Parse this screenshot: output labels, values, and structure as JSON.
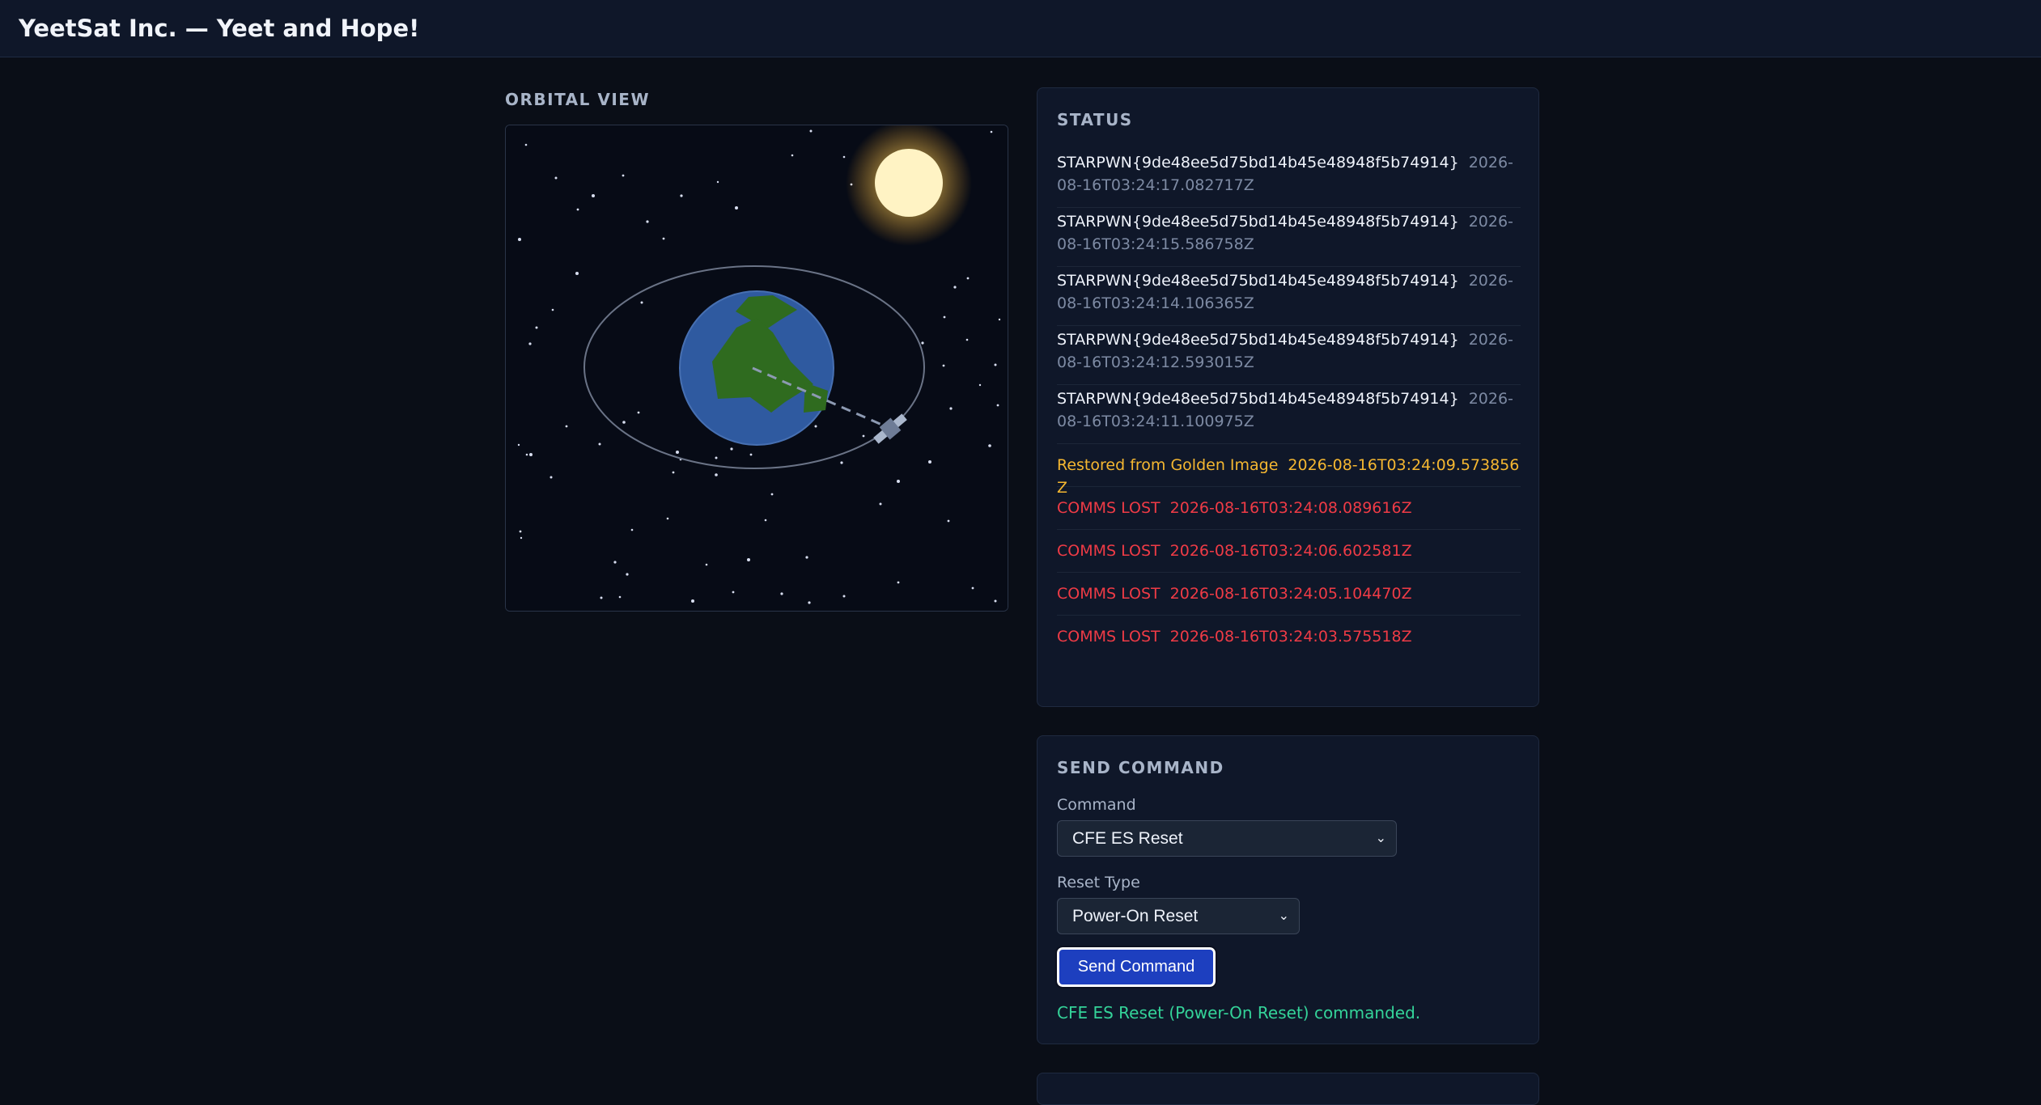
{
  "header": {
    "title": "YeetSat Inc. — Yeet and Hope!"
  },
  "orbital": {
    "heading": "ORBITAL VIEW"
  },
  "status": {
    "heading": "STATUS",
    "entries": [
      {
        "message": "STARPWN{9de48ee5d75bd14b45e48948f5b74914}",
        "timestamp": "2026-08-16T03:24:17.082717Z",
        "level": "flag"
      },
      {
        "message": "STARPWN{9de48ee5d75bd14b45e48948f5b74914}",
        "timestamp": "2026-08-16T03:24:15.586758Z",
        "level": "flag"
      },
      {
        "message": "STARPWN{9de48ee5d75bd14b45e48948f5b74914}",
        "timestamp": "2026-08-16T03:24:14.106365Z",
        "level": "flag"
      },
      {
        "message": "STARPWN{9de48ee5d75bd14b45e48948f5b74914}",
        "timestamp": "2026-08-16T03:24:12.593015Z",
        "level": "flag"
      },
      {
        "message": "STARPWN{9de48ee5d75bd14b45e48948f5b74914}",
        "timestamp": "2026-08-16T03:24:11.100975Z",
        "level": "flag"
      },
      {
        "message": "Restored from Golden Image",
        "timestamp": "2026-08-16T03:24:09.573856Z",
        "level": "warning"
      },
      {
        "message": "COMMS LOST",
        "timestamp": "2026-08-16T03:24:08.089616Z",
        "level": "error"
      },
      {
        "message": "COMMS LOST",
        "timestamp": "2026-08-16T03:24:06.602581Z",
        "level": "error"
      },
      {
        "message": "COMMS LOST",
        "timestamp": "2026-08-16T03:24:05.104470Z",
        "level": "error"
      },
      {
        "message": "COMMS LOST",
        "timestamp": "2026-08-16T03:24:03.575518Z",
        "level": "error"
      }
    ]
  },
  "command": {
    "heading": "SEND COMMAND",
    "command_label": "Command",
    "command_value": "CFE ES Reset",
    "reset_type_label": "Reset Type",
    "reset_type_value": "Power-On Reset",
    "send_label": "Send Command",
    "result": "CFE ES Reset (Power-On Reset) commanded."
  },
  "colors": {
    "background": "#0a0e17",
    "panel": "#0f1729",
    "flag_text": "#eef2fa",
    "warning": "#f5b731",
    "error": "#ef3b46",
    "success": "#34d399",
    "button": "#1d3fbf"
  },
  "icons": {
    "select_chevron": "chevron-down-icon"
  }
}
